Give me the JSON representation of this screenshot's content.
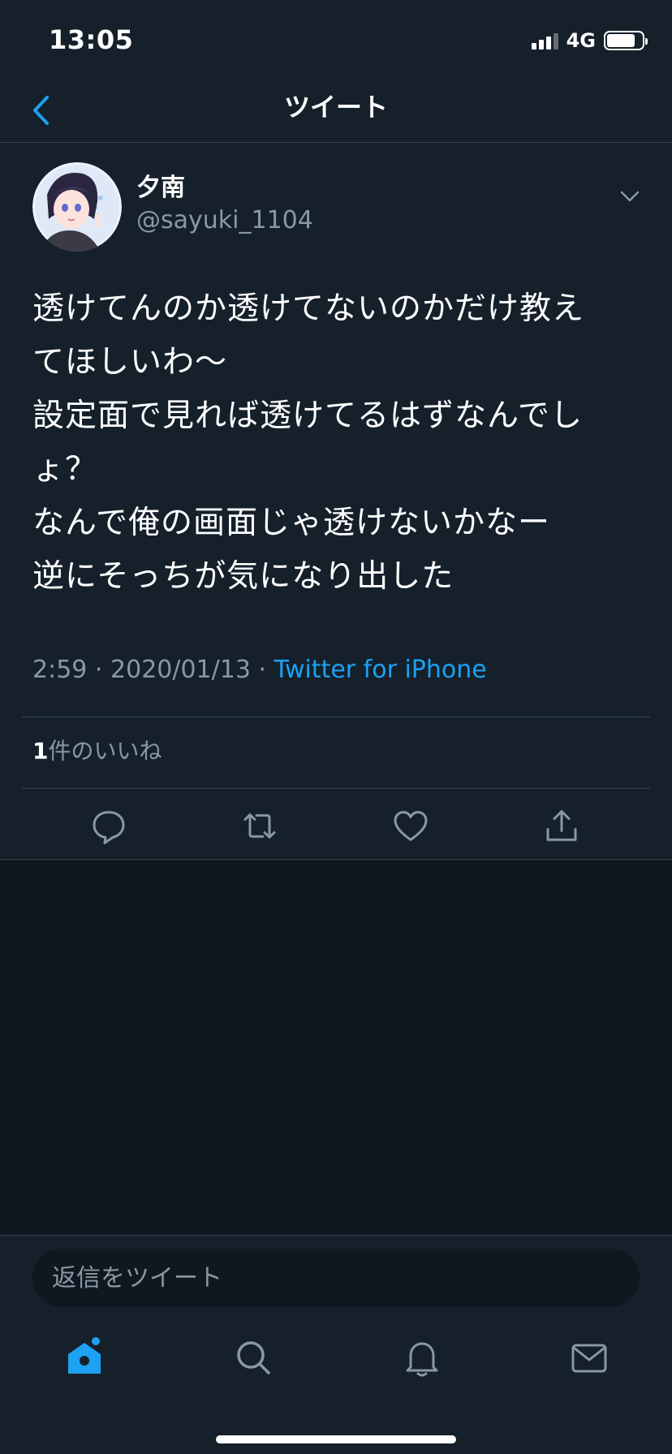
{
  "status": {
    "time": "13:05",
    "network": "4G"
  },
  "nav": {
    "title": "ツイート"
  },
  "tweet": {
    "display_name": "夕南",
    "handle": "@sayuki_1104",
    "text": "透けてんのか透けてないのかだけ教え\nてほしいわ〜\n設定面で見れば透けてるはずなんでし\nょ？\nなんで俺の画面じゃ透けないかなー\n逆にそっちが気になり出した",
    "time": "2:59",
    "date": "2020/01/13",
    "separator": "·",
    "source": "Twitter for iPhone",
    "like_count": "1",
    "like_label": "件のいいね"
  },
  "reply": {
    "placeholder": "返信をツイート"
  },
  "icons": {
    "back": "chevron-left-icon",
    "more": "chevron-down-icon",
    "reply": "comment-icon",
    "retweet": "retweet-icon",
    "like": "heart-icon",
    "share": "share-icon",
    "home": "home-icon",
    "search": "search-icon",
    "notifications": "bell-icon",
    "messages": "mail-icon"
  },
  "colors": {
    "background": "#15202b",
    "accent": "#1da1f2",
    "secondary_text": "#8899a6",
    "divider": "#38444d"
  }
}
